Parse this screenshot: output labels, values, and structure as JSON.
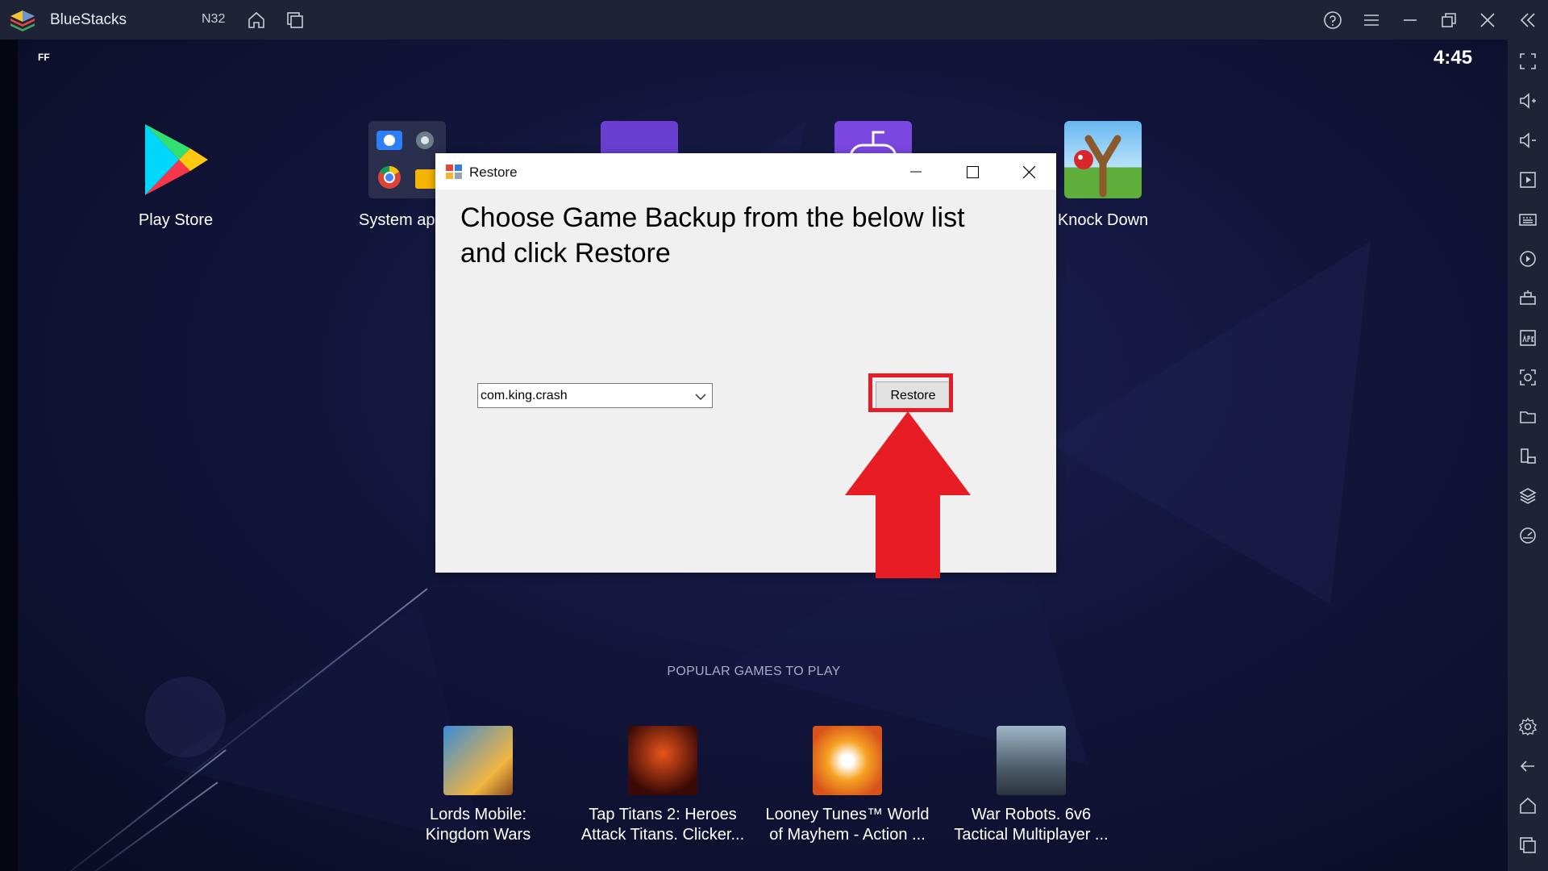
{
  "titlebar": {
    "app_name": "BlueStacks",
    "instance": "N32",
    "icons": [
      "home-icon",
      "multi-instance-icon",
      "help-icon",
      "menu-icon",
      "minimize-icon",
      "restore-icon",
      "close-icon",
      "collapse-sidebar-icon"
    ]
  },
  "statusbar": {
    "indicator": "FF",
    "time": "4:45"
  },
  "desktop_apps": [
    {
      "label": "Play Store"
    },
    {
      "label": "System ap"
    },
    {
      "label": "Knock Down"
    }
  ],
  "popular": {
    "title": "POPULAR GAMES TO PLAY",
    "games": [
      {
        "line1": "Lords Mobile:",
        "line2": "Kingdom Wars"
      },
      {
        "line1": "Tap Titans 2: Heroes",
        "line2": "Attack Titans. Clicker..."
      },
      {
        "line1": "Looney Tunes™ World",
        "line2": "of Mayhem - Action ..."
      },
      {
        "line1": "War Robots. 6v6",
        "line2": "Tactical Multiplayer ..."
      }
    ]
  },
  "dialog": {
    "title": "Restore",
    "heading": "Choose Game Backup from the below list and click Restore",
    "selected_backup": "com.king.crash",
    "restore_label": "Restore"
  },
  "colors": {
    "highlight": "#e81c24",
    "titlebar": "#1e2338",
    "dialog_bg": "#f0f0f0"
  }
}
